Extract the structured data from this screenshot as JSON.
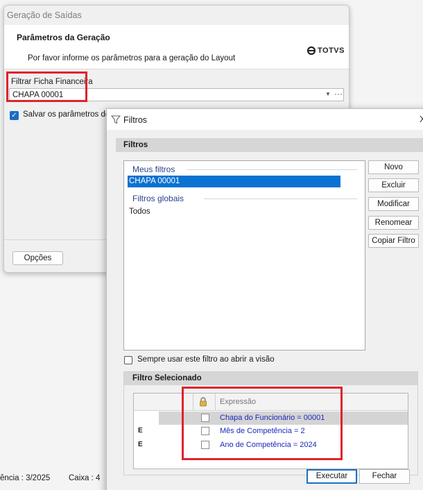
{
  "window_main": {
    "title": "Geração de Saídas",
    "heading": "Parâmetros da Geração",
    "subtitle": "Por favor informe os parâmetros para a geração do Layout",
    "logo_text": "TOTVS",
    "filtro_label": "Filtrar Ficha Financeira",
    "filtro_value": "CHAPA 00001",
    "salvar_label": "Salvar os parâmetros de g",
    "salvar_checked": true,
    "opcoes_label": "Opções"
  },
  "statusbar": {
    "competencia": "ência : 3/2025",
    "caixa": "Caixa : 4"
  },
  "window_filtros": {
    "title": "Filtros",
    "close_glyph": "X",
    "header": "Filtros",
    "meus_filtros_label": "Meus filtros",
    "meus_filtros": [
      "CHAPA 00001"
    ],
    "filtros_globais_label": "Filtros globais",
    "filtros_globais": [
      "Todos"
    ],
    "buttons": {
      "novo": "Novo",
      "excluir": "Excluir",
      "modificar": "Modificar",
      "renomear": "Renomear",
      "copiar": "Copiar Filtro"
    },
    "sempre_label": "Sempre usar este filtro ao abrir a visão",
    "sempre_checked": false,
    "selecionado_header": "Filtro Selecionado",
    "grid": {
      "expressao_header": "Expressão",
      "rows": [
        {
          "marker": "",
          "expression": "Chapa do Funcionário = 00001"
        },
        {
          "marker": "E",
          "expression": "Mês de Competência = 2"
        },
        {
          "marker": "E",
          "expression": "Ano de Competência = 2024"
        }
      ]
    },
    "executar": "Executar",
    "fechar": "Fechar"
  },
  "colors": {
    "accent_blue": "#0a72d1",
    "annotation_red": "#e1232a",
    "expression_text": "#1b2ab8"
  }
}
